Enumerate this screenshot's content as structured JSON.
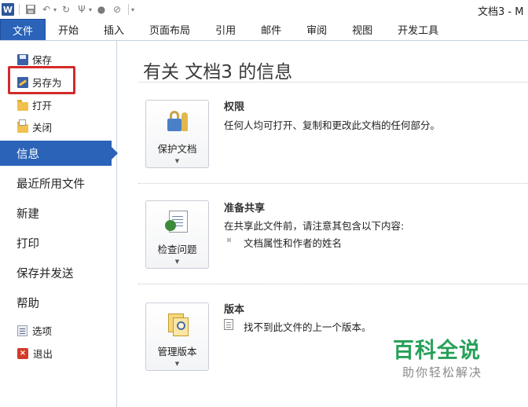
{
  "window": {
    "doc_title": "文档3 - M"
  },
  "qat": {
    "icons": [
      "word-app-icon",
      "save-icon",
      "undo-icon",
      "redo-icon",
      "format-painter-icon",
      "record-icon",
      "clear-format-icon",
      "customize-icon"
    ]
  },
  "ribbon": {
    "tabs": [
      {
        "label": "文件",
        "active": true
      },
      {
        "label": "开始"
      },
      {
        "label": "插入"
      },
      {
        "label": "页面布局"
      },
      {
        "label": "引用"
      },
      {
        "label": "邮件"
      },
      {
        "label": "审阅"
      },
      {
        "label": "视图"
      },
      {
        "label": "开发工具"
      }
    ]
  },
  "backstage": {
    "commands": [
      {
        "label": "保存",
        "icon": "save-icon"
      },
      {
        "label": "另存为",
        "icon": "save-as-icon",
        "highlighted": true
      },
      {
        "label": "打开",
        "icon": "open-folder-icon"
      },
      {
        "label": "关闭",
        "icon": "close-folder-icon"
      }
    ],
    "items": [
      {
        "label": "信息",
        "active": true
      },
      {
        "label": "最近所用文件"
      },
      {
        "label": "新建"
      },
      {
        "label": "打印"
      },
      {
        "label": "保存并发送"
      },
      {
        "label": "帮助"
      }
    ],
    "footer": [
      {
        "label": "选项",
        "icon": "options-icon"
      },
      {
        "label": "退出",
        "icon": "exit-icon"
      }
    ]
  },
  "info": {
    "heading": "有关 文档3 的信息",
    "sections": [
      {
        "button_label": "保护文档",
        "button_icon": "protect-document-icon",
        "title": "权限",
        "text": "任何人均可打开、复制和更改此文档的任何部分。"
      },
      {
        "button_label": "检查问题",
        "button_icon": "check-issues-icon",
        "title": "准备共享",
        "text": "在共享此文件前，请注意其包含以下内容:",
        "bullets": [
          "文档属性和作者的姓名"
        ]
      },
      {
        "button_label": "管理版本",
        "button_icon": "manage-versions-icon",
        "title": "版本",
        "text": "找不到此文件的上一个版本。"
      }
    ]
  },
  "watermark": {
    "main": "百科全说",
    "sub": "助你轻松解决"
  },
  "colors": {
    "accent": "#2a63b8",
    "highlight_box": "#d42a2a",
    "watermark": "#27a05a"
  }
}
